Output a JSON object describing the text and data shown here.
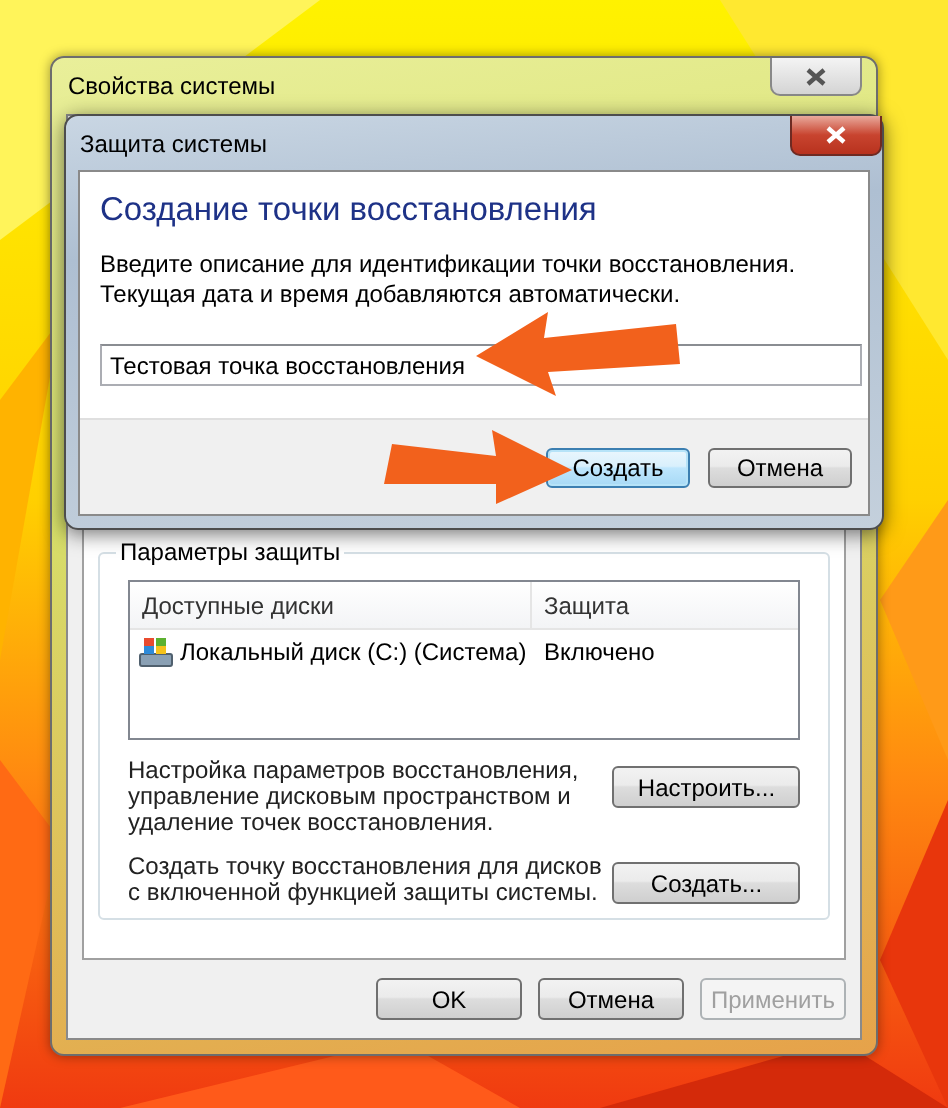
{
  "outer_window": {
    "title": "Свойства системы",
    "group_label": "Параметры защиты",
    "table": {
      "columns": [
        "Доступные диски",
        "Защита"
      ],
      "rows": [
        {
          "cells": [
            "Локальный диск (C:) (Система)",
            "Включено"
          ]
        }
      ]
    },
    "actions": [
      {
        "text": "Настройка параметров восстановления, управление дисковым пространством и удаление точек восстановления.",
        "button": "Настроить..."
      },
      {
        "text": "Создать точку восстановления для дисков с включенной функцией защиты системы.",
        "button": "Создать..."
      }
    ],
    "buttons": [
      {
        "label": "OK",
        "disabled": false
      },
      {
        "label": "Отмена",
        "disabled": false
      },
      {
        "label": "Применить",
        "disabled": true
      }
    ]
  },
  "dialog": {
    "title": "Защита системы",
    "heading": "Создание точки восстановления",
    "description": "Введите описание для идентификации точки восстановления. Текущая дата и время добавляются автоматически.",
    "field": {
      "value": "Тестовая точка восстановления"
    },
    "buttons": [
      {
        "label": "Создать",
        "default": true
      },
      {
        "label": "Отмена",
        "default": false
      }
    ]
  },
  "annotations": [
    {
      "kind": "arrow"
    },
    {
      "kind": "arrow"
    }
  ]
}
